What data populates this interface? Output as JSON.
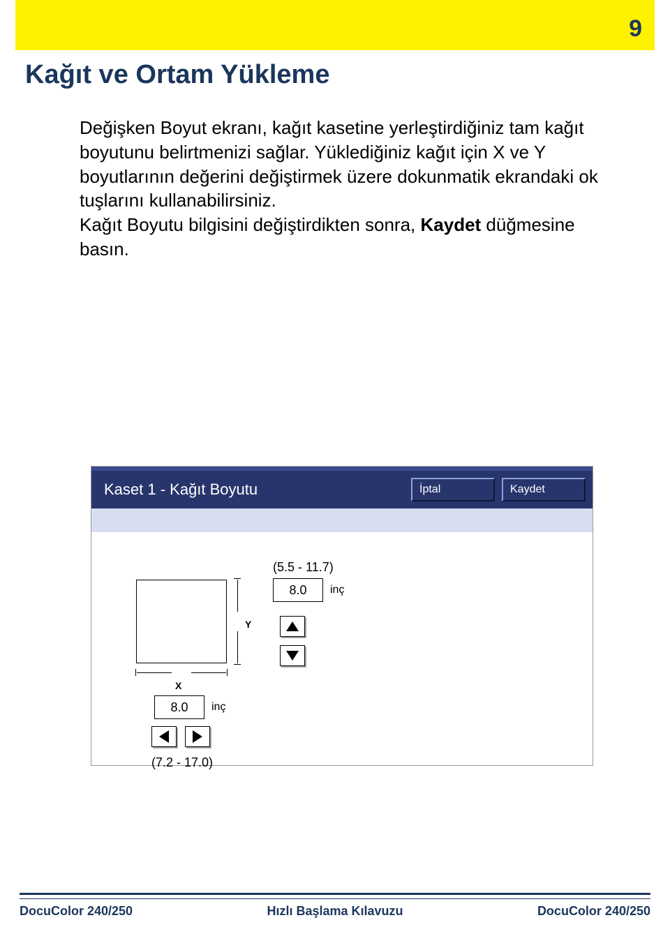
{
  "page_number": "9",
  "section_title": "Kağıt ve Ortam Yükleme",
  "paragraph_html": "Değişken Boyut ekranı, kağıt kasetine yerleştirdiğiniz tam kağıt boyutunu belirtmenizi sağlar. Yüklediğiniz kağıt için X ve Y boyutlarının değerini değiştirmek üzere dokunmatik ekrandaki ok tuşlarını kullanabilirsiniz.\nKağıt Boyutu bilgisini değiştirdikten sonra, <b>Kaydet</b> düğmesine basın.",
  "dialog": {
    "title": "Kaset 1 - Kağıt Boyutu",
    "cancel": "İptal",
    "save": "Kaydet",
    "y": {
      "range": "(5.5 - 11.7)",
      "value": "8.0",
      "unit": "inç",
      "label": "Y"
    },
    "x": {
      "range": "(7.2 - 17.0)",
      "value": "8.0",
      "unit": "inç",
      "label": "X"
    }
  },
  "footer": {
    "left": "DocuColor 240/250",
    "center": "Hızlı Başlama Kılavuzu",
    "right": "DocuColor 240/250"
  }
}
